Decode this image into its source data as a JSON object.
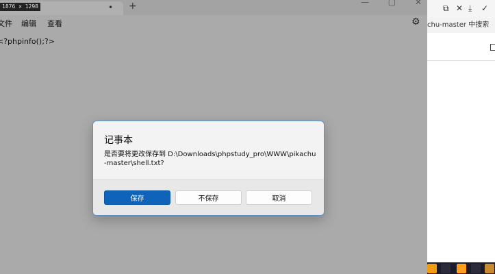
{
  "notepad": {
    "size_badge": "1876 × 1298",
    "tab_close": "•",
    "new_tab": "+",
    "window_controls": [
      "—",
      "▢",
      "✕"
    ],
    "menu": [
      "文件",
      "编辑",
      "查看"
    ],
    "settings_icon": "⚙",
    "content": "<?phpinfo();?>"
  },
  "right_panel": {
    "toolbar_icons": [
      "⧉",
      "✕",
      "⤓",
      "✓"
    ],
    "search_text": "chu-master 中搜索",
    "taskbar_colors": [
      "#f39c12",
      "#2b2b3c",
      "#ff9f1c",
      "#2b2b3c",
      "#c78b2f"
    ]
  },
  "dialog": {
    "title": "记事本",
    "message": "是否要将更改保存到 D:\\Downloads\\phpstudy_pro\\WWW\\pikachu-master\\shell.txt?",
    "buttons": {
      "save": "保存",
      "dont_save": "不保存",
      "cancel": "取消"
    }
  }
}
